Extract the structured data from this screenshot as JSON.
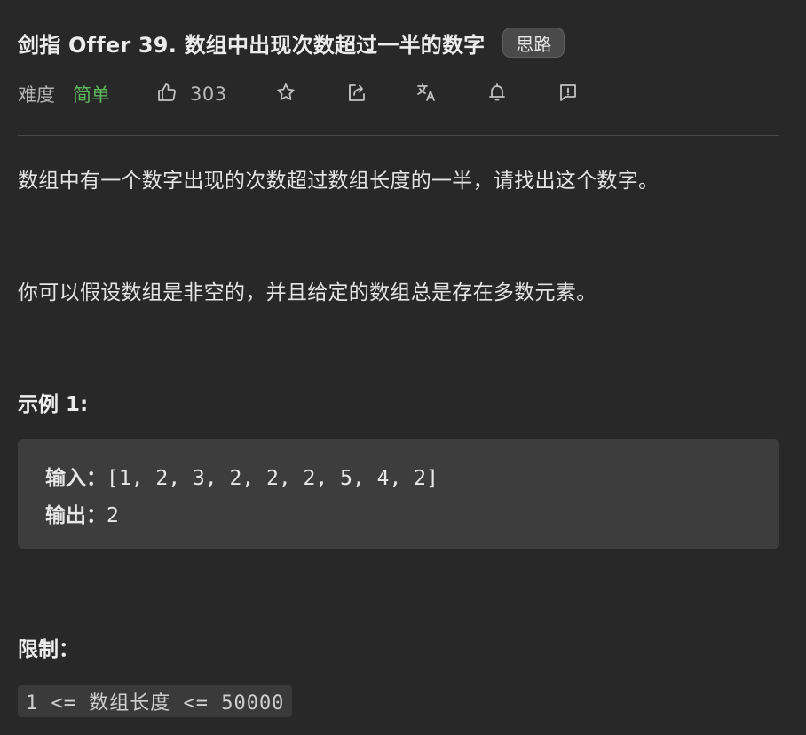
{
  "problem": {
    "title": "剑指 Offer 39. 数组中出现次数超过一半的数字",
    "tag": "思路"
  },
  "meta": {
    "difficulty_label": "难度",
    "difficulty": "简单",
    "difficulty_color": "#5cb85c",
    "likes": "303",
    "icons": [
      "thumbs-up-icon",
      "star-icon",
      "share-icon",
      "translate-icon",
      "bell-icon",
      "feedback-icon"
    ]
  },
  "description": {
    "p1": "数组中有一个数字出现的次数超过数组长度的一半，请找出这个数字。",
    "p2": "你可以假设数组是非空的，并且给定的数组总是存在多数元素。"
  },
  "example": {
    "heading": "示例 1:",
    "input_label": "输入：",
    "input_value": "[1, 2, 3, 2, 2, 2, 5, 4, 2]",
    "output_label": "输出：",
    "output_value": "2"
  },
  "constraints": {
    "heading": "限制：",
    "text": "1 <= 数组长度 <= 50000"
  }
}
